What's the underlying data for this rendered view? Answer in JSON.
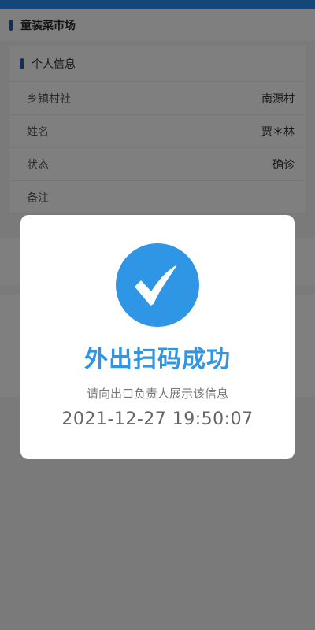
{
  "header": {
    "title": "童装菜市场"
  },
  "card": {
    "title": "个人信息",
    "rows": [
      {
        "label": "乡镇村社",
        "value": "南源村"
      },
      {
        "label": "姓名",
        "value": "贾＊林"
      },
      {
        "label": "状态",
        "value": "确诊"
      },
      {
        "label": "备注",
        "value": ""
      }
    ]
  },
  "modal": {
    "icon": "check-icon",
    "title": "外出扫码成功",
    "hint": "请向出口负责人展示该信息",
    "timestamp": "2021-12-27 19:50:07"
  },
  "colors": {
    "accent": "#2f95e5",
    "topbar": "#2d8cf0",
    "marker": "#1e5fb3"
  }
}
